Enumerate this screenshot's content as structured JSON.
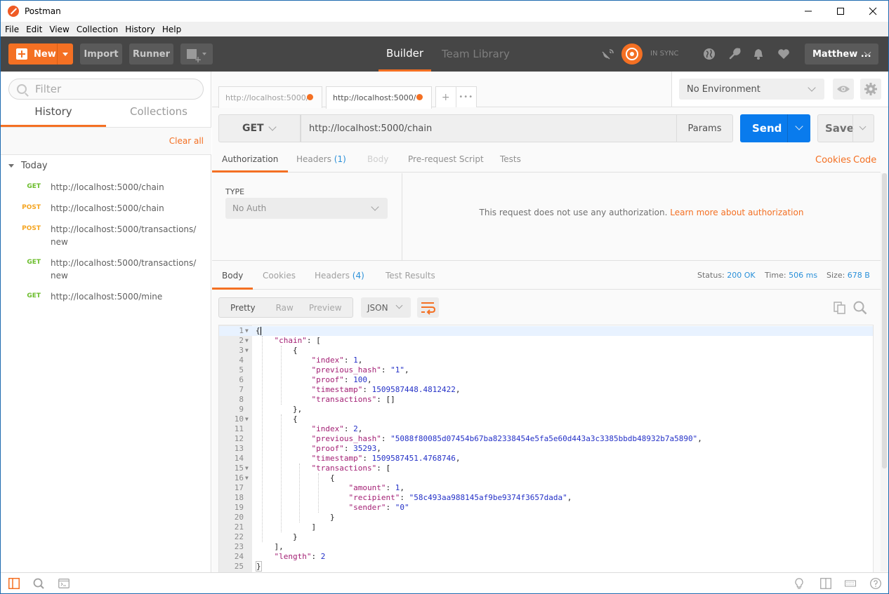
{
  "window": {
    "title": "Postman",
    "controls": [
      "minimize",
      "maximize",
      "close"
    ]
  },
  "menubar": [
    "File",
    "Edit",
    "View",
    "Collection",
    "History",
    "Help"
  ],
  "header": {
    "new_label": "New",
    "import_label": "Import",
    "runner_label": "Runner",
    "nav_tabs": [
      {
        "label": "Builder",
        "active": true
      },
      {
        "label": "Team Library",
        "active": false
      }
    ],
    "sync_status": "IN SYNC",
    "user_label": "Matthew ...",
    "accent_color": "#f47023"
  },
  "sidebar": {
    "filter_placeholder": "Filter",
    "tabs": [
      {
        "label": "History",
        "active": true
      },
      {
        "label": "Collections",
        "active": false
      }
    ],
    "clear_all_label": "Clear all",
    "group_label": "Today",
    "history": [
      {
        "method": "GET",
        "url": "http://localhost:5000/chain"
      },
      {
        "method": "POST",
        "url": "http://localhost:5000/chain"
      },
      {
        "method": "POST",
        "url": "http://localhost:5000/transactions/new"
      },
      {
        "method": "GET",
        "url": "http://localhost:5000/transactions/new"
      },
      {
        "method": "GET",
        "url": "http://localhost:5000/mine"
      }
    ]
  },
  "request_tabs": [
    {
      "label": "http://localhost:5000/",
      "active": false,
      "unsaved": true
    },
    {
      "label": "http://localhost:5000/",
      "active": true,
      "unsaved": true
    }
  ],
  "tab_actions": {
    "add": "+",
    "more": "•••"
  },
  "environment": {
    "selected": "No Environment"
  },
  "request": {
    "method": "GET",
    "url": "http://localhost:5000/chain",
    "params_label": "Params",
    "send_label": "Send",
    "save_label": "Save",
    "tabs": [
      {
        "label": "Authorization",
        "count": null,
        "state": "active"
      },
      {
        "label": "Headers",
        "count": "(1)",
        "state": "normal"
      },
      {
        "label": "Body",
        "count": null,
        "state": "disabled"
      },
      {
        "label": "Pre-request Script",
        "count": null,
        "state": "normal"
      },
      {
        "label": "Tests",
        "count": null,
        "state": "normal"
      }
    ],
    "cookies_link": "Cookies",
    "code_link": "Code"
  },
  "auth": {
    "type_label": "TYPE",
    "type_value": "No Auth",
    "message": "This request does not use any authorization.",
    "learn_more": "Learn more about authorization"
  },
  "response": {
    "tabs": [
      {
        "label": "Body",
        "count": null,
        "active": true
      },
      {
        "label": "Cookies",
        "count": null,
        "active": false
      },
      {
        "label": "Headers",
        "count": "(4)",
        "active": false
      },
      {
        "label": "Test Results",
        "count": null,
        "active": false
      }
    ],
    "status_label": "Status:",
    "status_value": "200 OK",
    "time_label": "Time:",
    "time_value": "506 ms",
    "size_label": "Size:",
    "size_value": "678 B",
    "view_modes": [
      {
        "label": "Pretty",
        "active": true
      },
      {
        "label": "Raw",
        "active": false
      },
      {
        "label": "Preview",
        "active": false
      }
    ],
    "format": "JSON",
    "body_lines": [
      {
        "n": "1",
        "fold": true,
        "indent": 0,
        "html": "{"
      },
      {
        "n": "2",
        "fold": true,
        "indent": 1,
        "html": "<span class='k'>\"chain\"</span>: ["
      },
      {
        "n": "3",
        "fold": true,
        "indent": 2,
        "html": "{"
      },
      {
        "n": "4",
        "fold": false,
        "indent": 3,
        "html": "<span class='k'>\"index\"</span>: <span class='n'>1</span>,"
      },
      {
        "n": "5",
        "fold": false,
        "indent": 3,
        "html": "<span class='k'>\"previous_hash\"</span>: <span class='s'>\"1\"</span>,"
      },
      {
        "n": "6",
        "fold": false,
        "indent": 3,
        "html": "<span class='k'>\"proof\"</span>: <span class='n'>100</span>,"
      },
      {
        "n": "7",
        "fold": false,
        "indent": 3,
        "html": "<span class='k'>\"timestamp\"</span>: <span class='n'>1509587448.4812422</span>,"
      },
      {
        "n": "8",
        "fold": false,
        "indent": 3,
        "html": "<span class='k'>\"transactions\"</span>: []"
      },
      {
        "n": "9",
        "fold": false,
        "indent": 2,
        "html": "},"
      },
      {
        "n": "10",
        "fold": true,
        "indent": 2,
        "html": "{"
      },
      {
        "n": "11",
        "fold": false,
        "indent": 3,
        "html": "<span class='k'>\"index\"</span>: <span class='n'>2</span>,"
      },
      {
        "n": "12",
        "fold": false,
        "indent": 3,
        "html": "<span class='k'>\"previous_hash\"</span>: <span class='s'>\"5088f80085d07454b67ba82338454e5fa5e60d443a3c3385bbdb48932b7a5890\"</span>,"
      },
      {
        "n": "13",
        "fold": false,
        "indent": 3,
        "html": "<span class='k'>\"proof\"</span>: <span class='n'>35293</span>,"
      },
      {
        "n": "14",
        "fold": false,
        "indent": 3,
        "html": "<span class='k'>\"timestamp\"</span>: <span class='n'>1509587451.4768746</span>,"
      },
      {
        "n": "15",
        "fold": true,
        "indent": 3,
        "html": "<span class='k'>\"transactions\"</span>: ["
      },
      {
        "n": "16",
        "fold": true,
        "indent": 4,
        "html": "{"
      },
      {
        "n": "17",
        "fold": false,
        "indent": 5,
        "html": "<span class='k'>\"amount\"</span>: <span class='n'>1</span>,"
      },
      {
        "n": "18",
        "fold": false,
        "indent": 5,
        "html": "<span class='k'>\"recipient\"</span>: <span class='s'>\"58c493aa988145af9be9374f3657dada\"</span>,"
      },
      {
        "n": "19",
        "fold": false,
        "indent": 5,
        "html": "<span class='k'>\"sender\"</span>: <span class='s'>\"0\"</span>"
      },
      {
        "n": "20",
        "fold": false,
        "indent": 4,
        "html": "}"
      },
      {
        "n": "21",
        "fold": false,
        "indent": 3,
        "html": "]"
      },
      {
        "n": "22",
        "fold": false,
        "indent": 2,
        "html": "}"
      },
      {
        "n": "23",
        "fold": false,
        "indent": 1,
        "html": "],"
      },
      {
        "n": "24",
        "fold": false,
        "indent": 1,
        "html": "<span class='k'>\"length\"</span>: <span class='n'>2</span>"
      },
      {
        "n": "25",
        "fold": false,
        "indent": 0,
        "html": "<span class='bracebox'>}</span>"
      }
    ]
  },
  "colors": {
    "orange": "#f47023",
    "blue": "#097bed",
    "get": "#6bbd2b",
    "post": "#f5a623",
    "header_bg": "#464646"
  }
}
